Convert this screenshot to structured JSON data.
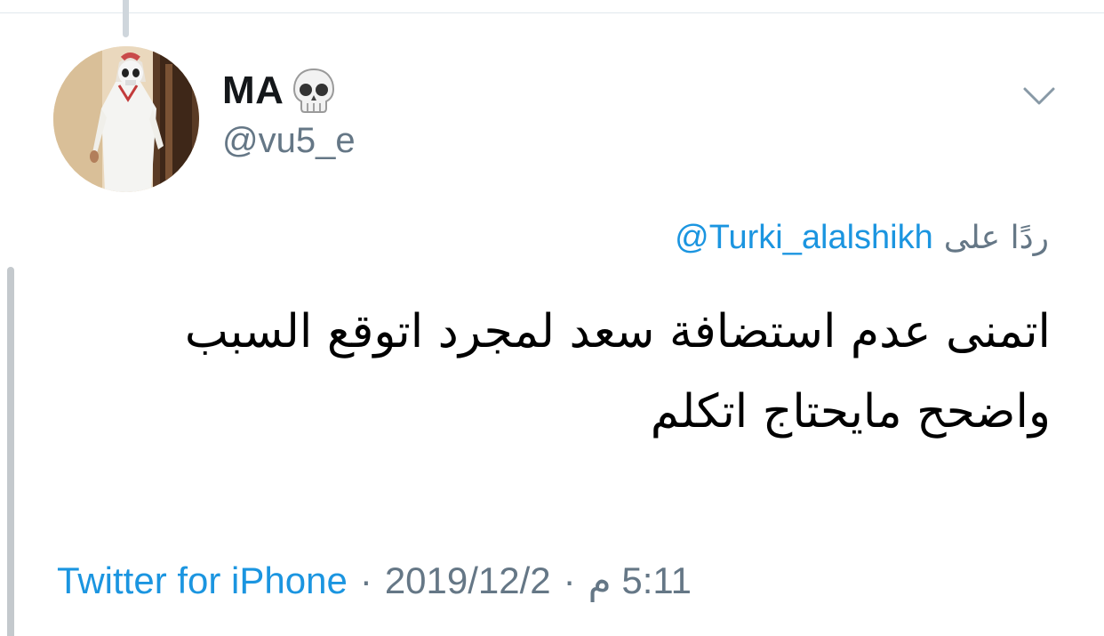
{
  "tweet": {
    "display_name": "MA",
    "name_emoji": "skull-emoji",
    "handle": "@vu5_e",
    "reply_prefix": "ردًا على",
    "reply_to": "@Turki_alalshikh",
    "text": "اتمنى عدم استضافة سعد لمجرد اتوقع السبب\nواضحح مايحتاج اتكلم",
    "source": "Twitter for iPhone",
    "separator": "·",
    "date": "2019/12/2",
    "time": "5:11 م"
  },
  "icons": {
    "more_menu": "chevron-down-icon",
    "avatar": "profile-photo"
  },
  "colors": {
    "link": "#1b95e0",
    "secondary_text": "#657786",
    "primary_text": "#14171a",
    "thread_line": "#cfd6dc"
  }
}
